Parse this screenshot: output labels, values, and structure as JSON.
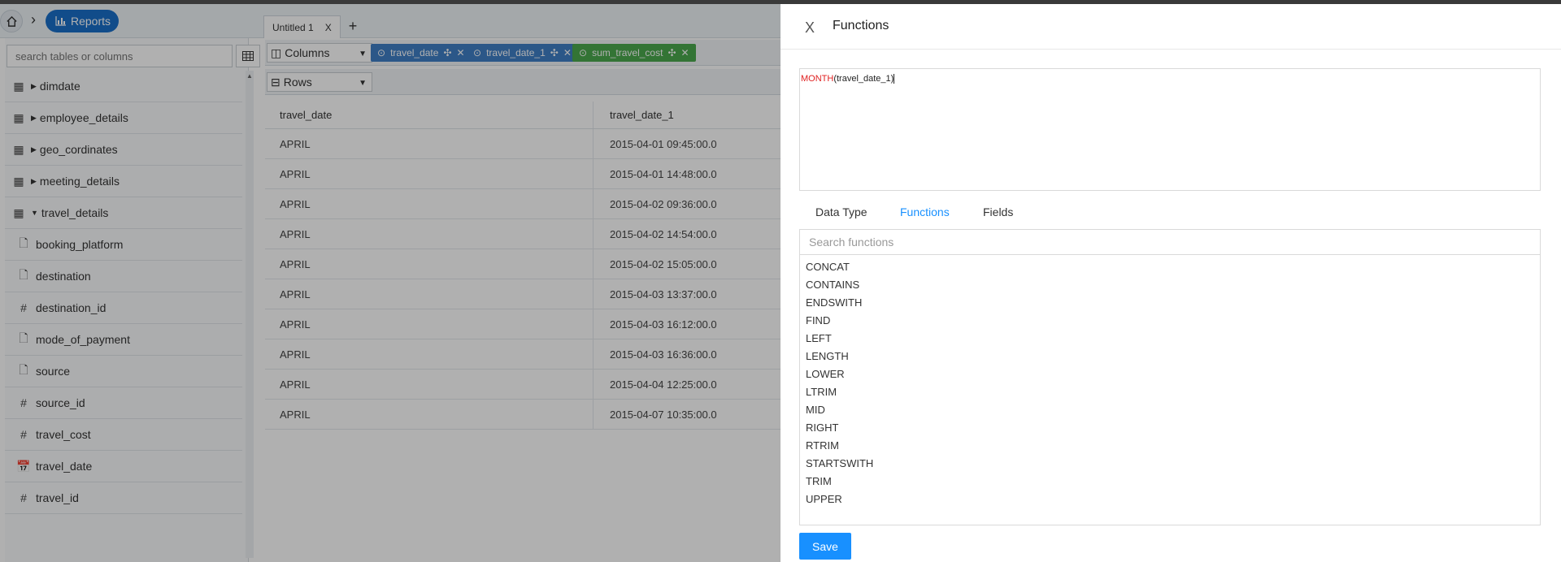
{
  "breadcrumb": {
    "current": "Reports"
  },
  "sidebar": {
    "search_placeholder": "search tables or columns",
    "tables": [
      {
        "name": "dimdate",
        "expanded": false
      },
      {
        "name": "employee_details",
        "expanded": false
      },
      {
        "name": "geo_cordinates",
        "expanded": false
      },
      {
        "name": "meeting_details",
        "expanded": false
      },
      {
        "name": "travel_details",
        "expanded": true
      }
    ],
    "columns": [
      {
        "name": "booking_platform",
        "type": "text"
      },
      {
        "name": "destination",
        "type": "text"
      },
      {
        "name": "destination_id",
        "type": "number"
      },
      {
        "name": "mode_of_payment",
        "type": "text"
      },
      {
        "name": "source",
        "type": "text"
      },
      {
        "name": "source_id",
        "type": "number"
      },
      {
        "name": "travel_cost",
        "type": "number"
      },
      {
        "name": "travel_date",
        "type": "date"
      },
      {
        "name": "travel_id",
        "type": "number"
      }
    ]
  },
  "report_tab": {
    "label": "Untitled 1",
    "close": "X",
    "add": "+"
  },
  "shelves": {
    "columns_label": "Columns",
    "rows_label": "Rows",
    "pills": [
      {
        "label": "travel_date",
        "color": "#3f7fc6"
      },
      {
        "label": "travel_date_1",
        "color": "#3f7fc6"
      },
      {
        "label": "sum_travel_cost",
        "color": "#4aa84e"
      }
    ]
  },
  "grid": {
    "headers": [
      "travel_date",
      "travel_date_1"
    ],
    "rows": [
      [
        "APRIL",
        "2015-04-01 09:45:00.0"
      ],
      [
        "APRIL",
        "2015-04-01 14:48:00.0"
      ],
      [
        "APRIL",
        "2015-04-02 09:36:00.0"
      ],
      [
        "APRIL",
        "2015-04-02 14:54:00.0"
      ],
      [
        "APRIL",
        "2015-04-02 15:05:00.0"
      ],
      [
        "APRIL",
        "2015-04-03 13:37:00.0"
      ],
      [
        "APRIL",
        "2015-04-03 16:12:00.0"
      ],
      [
        "APRIL",
        "2015-04-03 16:36:00.0"
      ],
      [
        "APRIL",
        "2015-04-04 12:25:00.0"
      ],
      [
        "APRIL",
        "2015-04-07 10:35:00.0"
      ]
    ]
  },
  "panel": {
    "title": "Functions",
    "close_glyph": "X",
    "expression": {
      "function": "MONTH",
      "argument": "(travel_date_1)"
    },
    "tabs": [
      "Data Type",
      "Functions",
      "Fields"
    ],
    "active_tab": "Functions",
    "search_placeholder": "Search functions",
    "functions": [
      "CONCAT",
      "CONTAINS",
      "ENDSWITH",
      "FIND",
      "LEFT",
      "LENGTH",
      "LOWER",
      "LTRIM",
      "MID",
      "RIGHT",
      "RTRIM",
      "STARTSWITH",
      "TRIM",
      "UPPER"
    ],
    "save_label": "Save"
  },
  "colors": {
    "accent": "#1890ff",
    "function_keyword": "#e02020",
    "reports_pill": "#1a6fc9"
  }
}
